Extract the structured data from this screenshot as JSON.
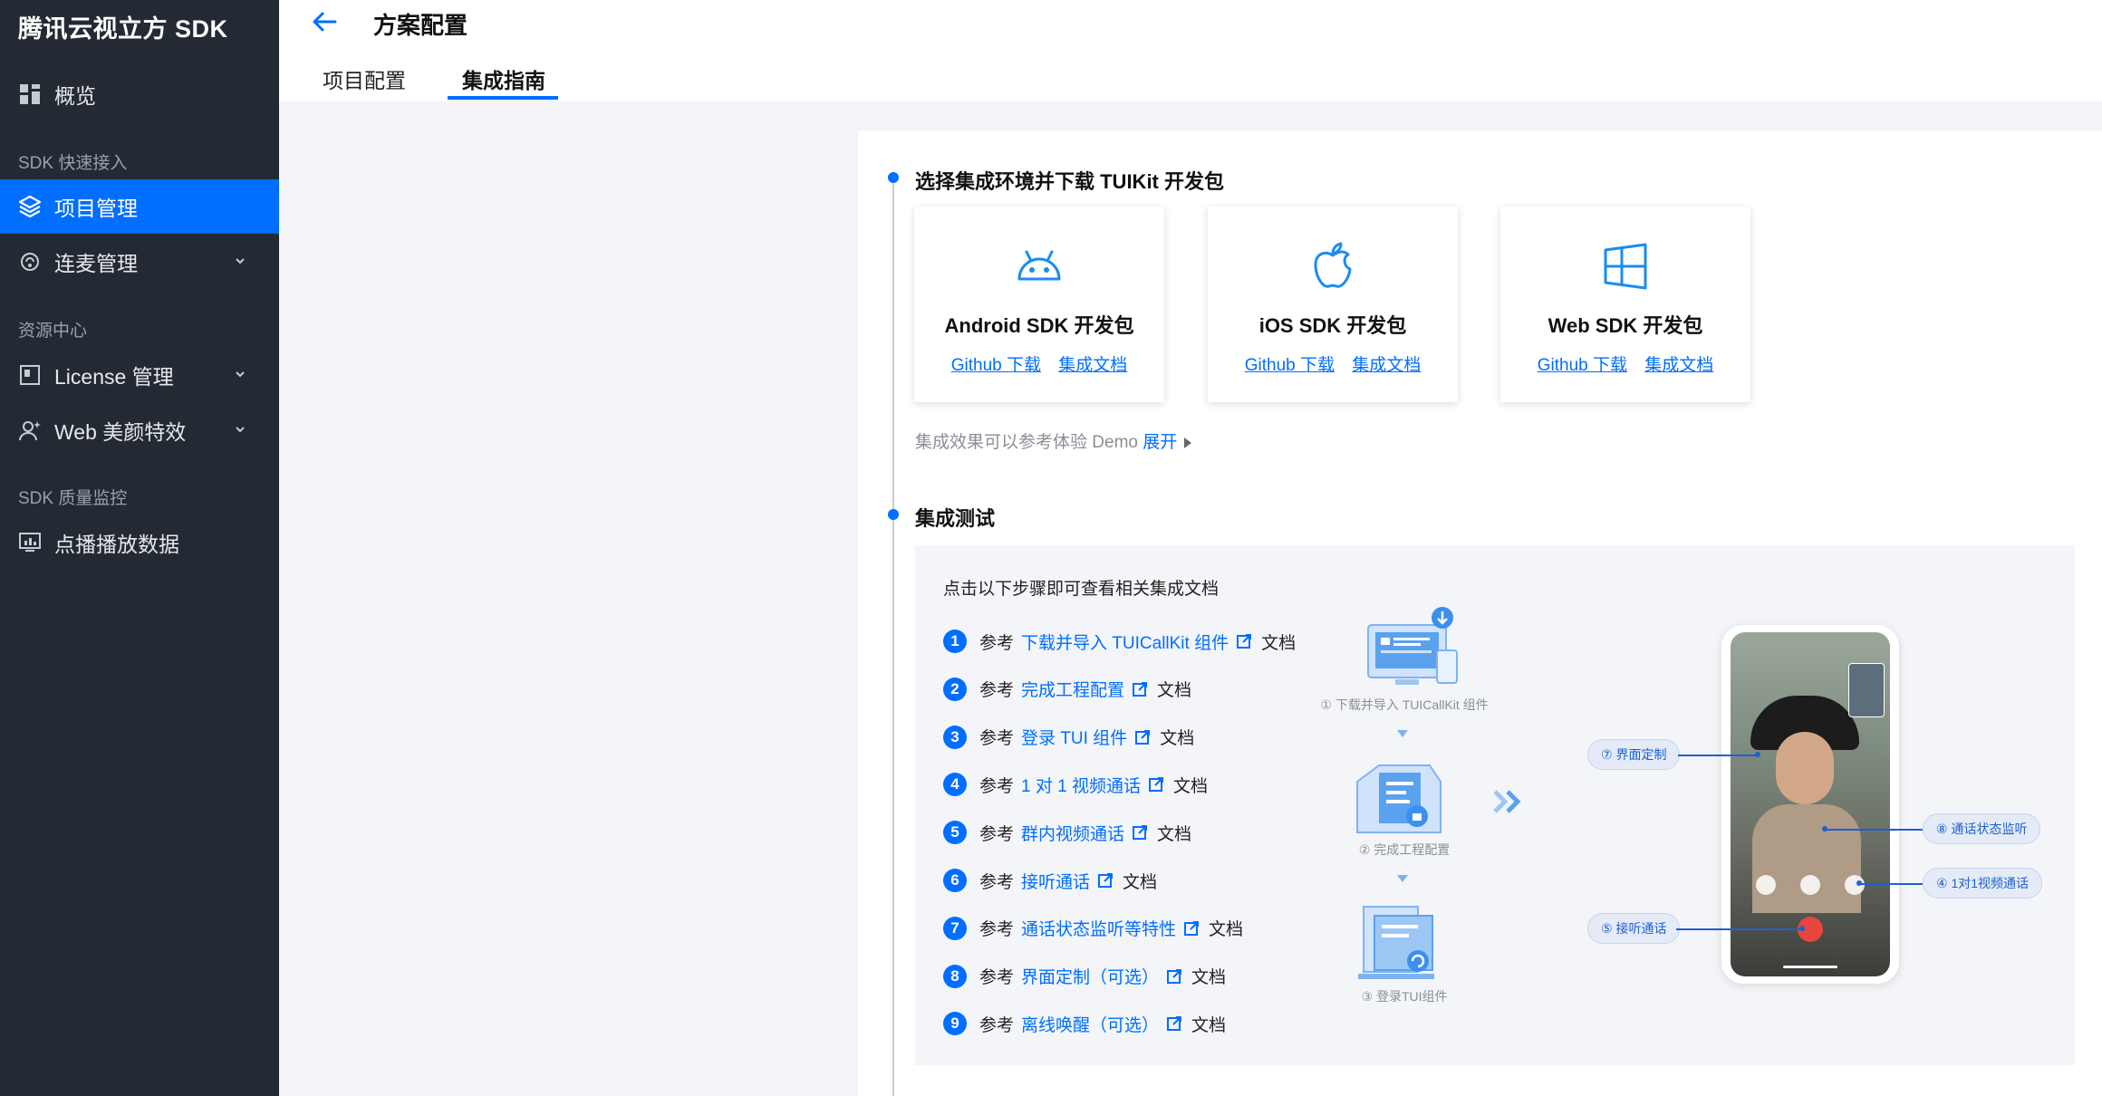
{
  "sidebar": {
    "brand": "腾讯云视立方 SDK",
    "overview": "概览",
    "section_quick": "SDK 快速接入",
    "project_mgmt": "项目管理",
    "mic_mgmt": "连麦管理",
    "section_resource": "资源中心",
    "license_mgmt": "License 管理",
    "web_beauty": "Web 美颜特效",
    "section_quality": "SDK 质量监控",
    "vod_data": "点播播放数据"
  },
  "header": {
    "title": "方案配置",
    "tabs": [
      "项目配置",
      "集成指南"
    ]
  },
  "download_section": {
    "title": "选择集成环境并下载 TUIKit 开发包",
    "cards": [
      {
        "name": "Android SDK 开发包",
        "github": "Github 下载",
        "docs": "集成文档",
        "icon": "android-icon"
      },
      {
        "name": "iOS SDK 开发包",
        "github": "Github 下载",
        "docs": "集成文档",
        "icon": "apple-icon"
      },
      {
        "name": "Web SDK 开发包",
        "github": "Github 下载",
        "docs": "集成文档",
        "icon": "windows-icon"
      }
    ],
    "demo_hint": "集成效果可以参考体验 Demo",
    "expand": "展开"
  },
  "test_section": {
    "title": "集成测试",
    "intro": "点击以下步骤即可查看相关集成文档",
    "ref": "参考",
    "doc": "文档",
    "steps": [
      {
        "num": "1",
        "link": "下载并导入 TUICallKit 组件"
      },
      {
        "num": "2",
        "link": "完成工程配置"
      },
      {
        "num": "3",
        "link": "登录 TUI 组件"
      },
      {
        "num": "4",
        "link": "1 对 1 视频通话"
      },
      {
        "num": "5",
        "link": "群内视频通话"
      },
      {
        "num": "6",
        "link": "接听通话"
      },
      {
        "num": "7",
        "link": "通话状态监听等特性"
      },
      {
        "num": "8",
        "link": "界面定制（可选）"
      },
      {
        "num": "9",
        "link": "离线唤醒（可选）"
      }
    ],
    "flow": [
      "① 下载并导入 TUICallKit 组件",
      "② 完成工程配置",
      "③ 登录TUI组件"
    ],
    "callouts": [
      "⑦ 界面定制",
      "⑧ 通话状态监听",
      "④ 1对1视频通话",
      "⑤ 接听通话"
    ]
  },
  "colors": {
    "accent": "#006eff",
    "sidebar_bg": "#242a33"
  }
}
